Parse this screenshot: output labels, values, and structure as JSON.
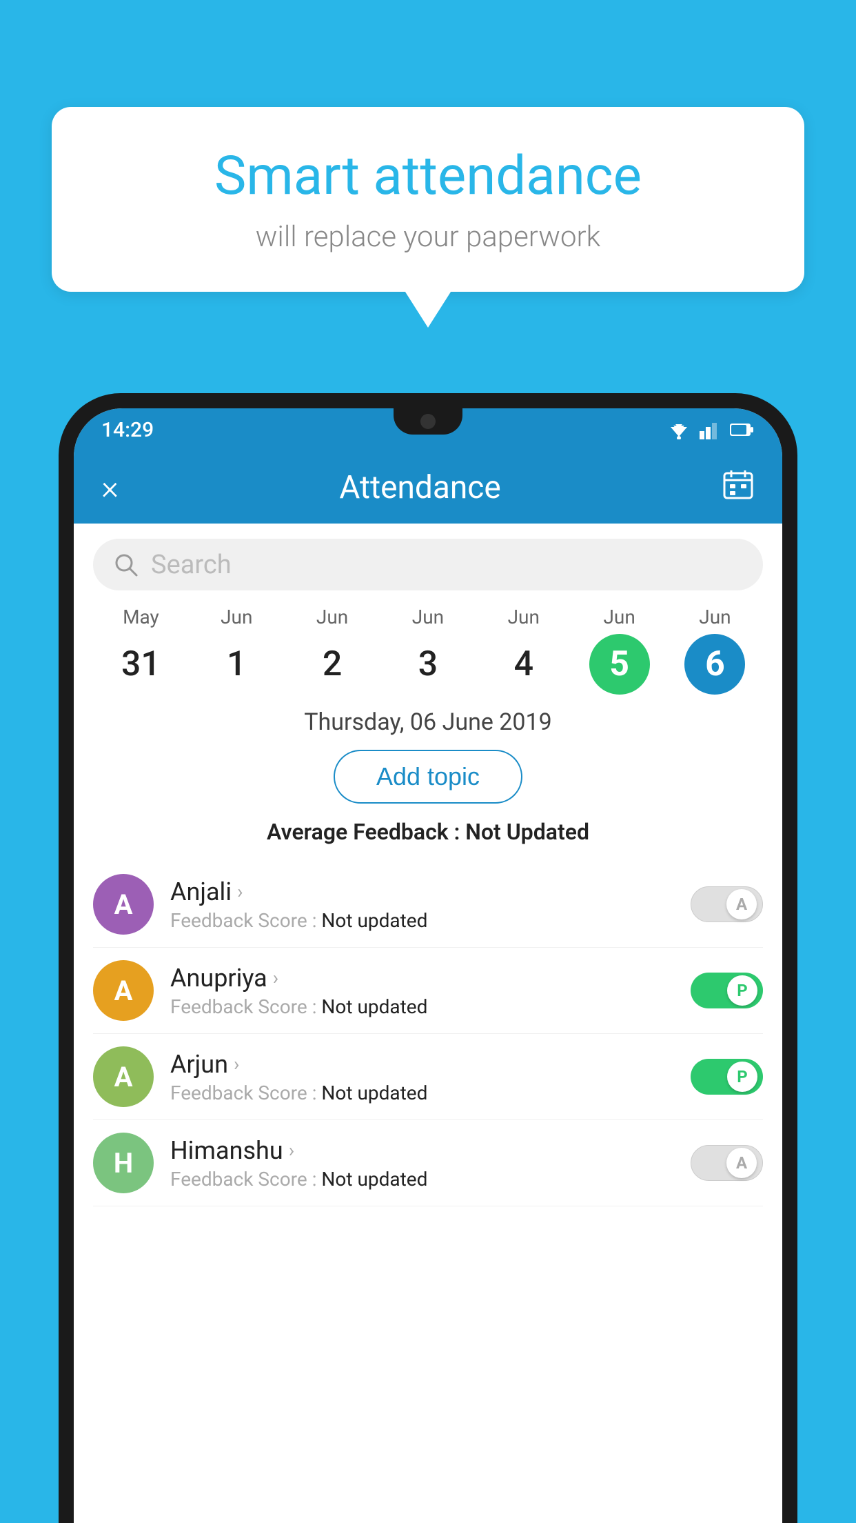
{
  "background_color": "#29B6E8",
  "speech_bubble": {
    "title": "Smart attendance",
    "subtitle": "will replace your paperwork"
  },
  "status_bar": {
    "time": "14:29"
  },
  "app_header": {
    "title": "Attendance",
    "close_label": "×",
    "calendar_label": "📅"
  },
  "search": {
    "placeholder": "Search"
  },
  "dates": [
    {
      "month": "May",
      "day": "31",
      "state": "normal"
    },
    {
      "month": "Jun",
      "day": "1",
      "state": "normal"
    },
    {
      "month": "Jun",
      "day": "2",
      "state": "normal"
    },
    {
      "month": "Jun",
      "day": "3",
      "state": "normal"
    },
    {
      "month": "Jun",
      "day": "4",
      "state": "normal"
    },
    {
      "month": "Jun",
      "day": "5",
      "state": "today"
    },
    {
      "month": "Jun",
      "day": "6",
      "state": "selected"
    }
  ],
  "selected_date_label": "Thursday, 06 June 2019",
  "add_topic_label": "Add topic",
  "avg_feedback_label": "Average Feedback :",
  "avg_feedback_value": "Not Updated",
  "students": [
    {
      "name": "Anjali",
      "avatar_letter": "A",
      "avatar_color": "#9c5fb5",
      "feedback_label": "Feedback Score :",
      "feedback_value": "Not updated",
      "toggle_state": "off",
      "toggle_letter": "A"
    },
    {
      "name": "Anupriya",
      "avatar_letter": "A",
      "avatar_color": "#e6a020",
      "feedback_label": "Feedback Score :",
      "feedback_value": "Not updated",
      "toggle_state": "on",
      "toggle_letter": "P"
    },
    {
      "name": "Arjun",
      "avatar_letter": "A",
      "avatar_color": "#8fbc5a",
      "feedback_label": "Feedback Score :",
      "feedback_value": "Not updated",
      "toggle_state": "on",
      "toggle_letter": "P"
    },
    {
      "name": "Himanshu",
      "avatar_letter": "H",
      "avatar_color": "#7bc47f",
      "feedback_label": "Feedback Score :",
      "feedback_value": "Not updated",
      "toggle_state": "off",
      "toggle_letter": "A"
    }
  ]
}
